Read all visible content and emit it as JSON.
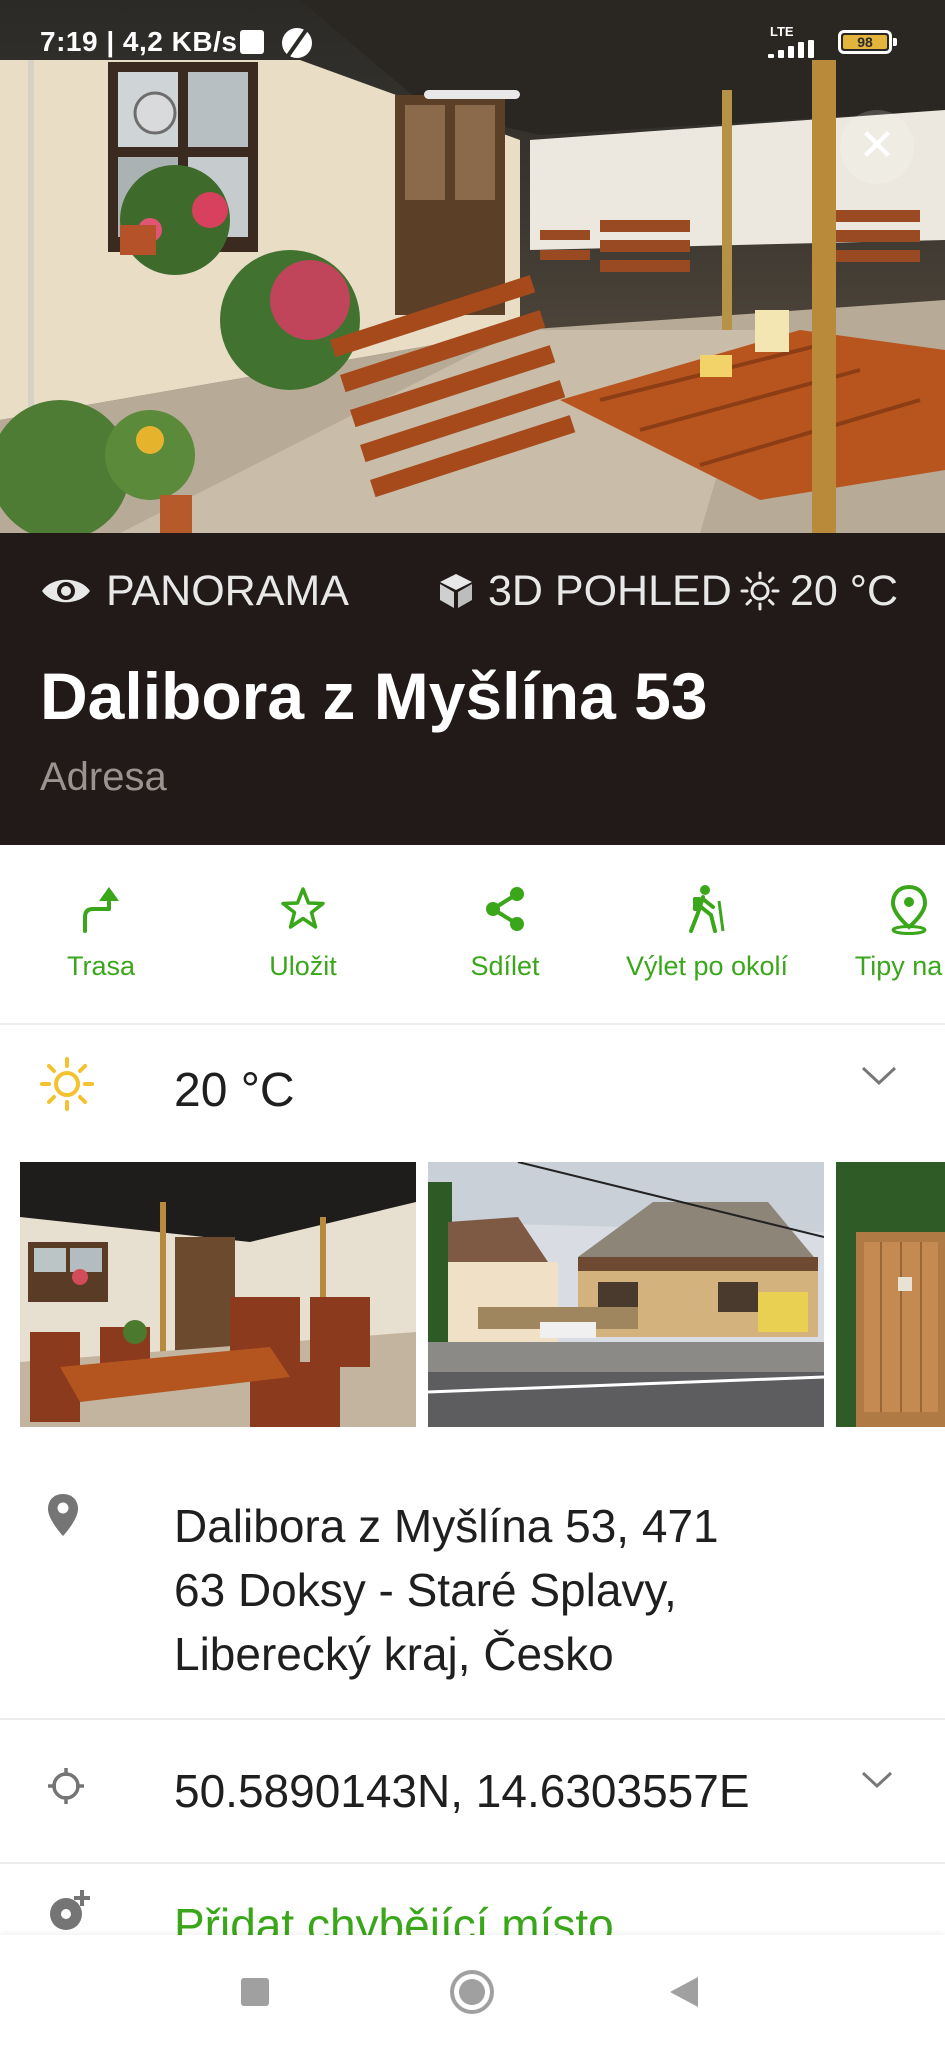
{
  "status_bar": {
    "time_speed": "7:19 | 4,2 KB/s",
    "network": "LTE",
    "battery": "98"
  },
  "chips": {
    "panorama": "PANORAMA",
    "view3d": "3D POHLED",
    "temperature": "20 °C"
  },
  "place": {
    "title": "Dalibora z Myšlína 53",
    "type": "Adresa"
  },
  "actions": [
    {
      "label": "Trasa",
      "icon": "route-icon"
    },
    {
      "label": "Uložit",
      "icon": "star-icon"
    },
    {
      "label": "Sdílet",
      "icon": "share-icon"
    },
    {
      "label": "Výlet po okolí",
      "icon": "hiking-icon"
    },
    {
      "label": "Tipy na v",
      "icon": "location-pin-icon"
    }
  ],
  "weather": {
    "temperature": "20 °C"
  },
  "details": {
    "address_lines": [
      "Dalibora z Myšlína 53, 471",
      "63 Doksy - Staré Splavy,",
      "Liberecký kraj, Česko"
    ],
    "coordinates": "50.5890143N, 14.6303557E",
    "add_missing_place": "Přidat chybějící místo"
  },
  "colors": {
    "accent_green": "#3aa61a",
    "panel_dark": "#221a18",
    "weather_sun": "#f3c22f"
  }
}
